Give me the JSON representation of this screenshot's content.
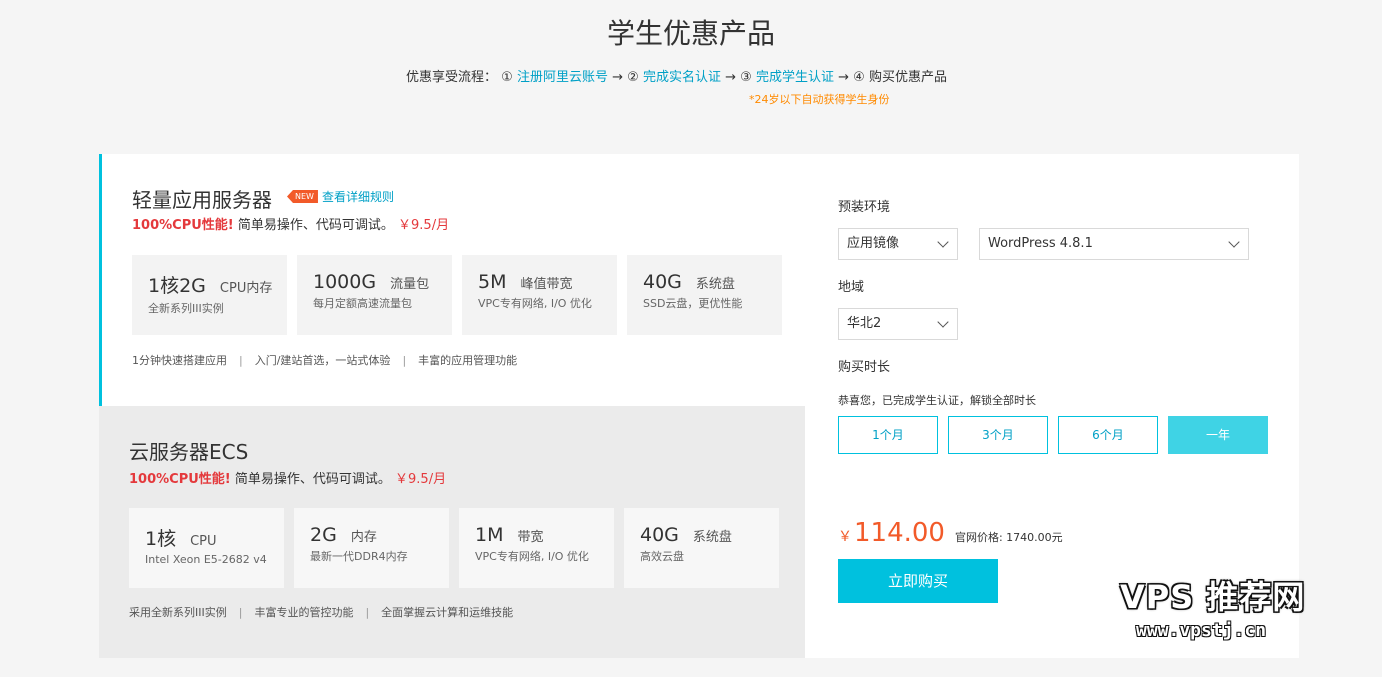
{
  "page": {
    "title": "学生优惠产品",
    "flow_label": "优惠享受流程：",
    "steps": [
      {
        "num": "①",
        "label": "注册阿里云账号"
      },
      {
        "num": "②",
        "label": "完成实名认证"
      },
      {
        "num": "③",
        "label": "完成学生认证"
      },
      {
        "num": "④",
        "label": "购买优惠产品"
      }
    ],
    "arrow": "→",
    "note": "*24岁以下自动获得学生身份"
  },
  "products": [
    {
      "title": "轻量应用服务器",
      "badge": "NEW",
      "rules_link": "查看详细规则",
      "highlight": "100%CPU性能!",
      "desc": "简单易操作、代码可调试。",
      "price": "￥9.5/月",
      "specs": [
        {
          "value": "1核2G",
          "unit": "CPU内存",
          "sub": "全新系列III实例"
        },
        {
          "value": "1000G",
          "unit": "流量包",
          "sub": "每月定额高速流量包"
        },
        {
          "value": "5M",
          "unit": "峰值带宽",
          "sub": "VPC专有网络, I/O 优化"
        },
        {
          "value": "40G",
          "unit": "系统盘",
          "sub": "SSD云盘，更优性能"
        }
      ],
      "features": [
        "1分钟快速搭建应用",
        "入门/建站首选，一站式体验",
        "丰富的应用管理功能"
      ]
    },
    {
      "title": "云服务器ECS",
      "highlight": "100%CPU性能!",
      "desc": "简单易操作、代码可调试。",
      "price": "￥9.5/月",
      "specs": [
        {
          "value": "1核",
          "unit": "CPU",
          "sub": "Intel Xeon E5-2682 v4"
        },
        {
          "value": "2G",
          "unit": "内存",
          "sub": "最新一代DDR4内存"
        },
        {
          "value": "1M",
          "unit": "带宽",
          "sub": "VPC专有网络, I/O 优化"
        },
        {
          "value": "40G",
          "unit": "系统盘",
          "sub": "高效云盘"
        }
      ],
      "features": [
        "采用全新系列III实例",
        "丰富专业的管控功能",
        "全面掌握云计算和运维技能"
      ]
    }
  ],
  "features_sep": "|",
  "config": {
    "env_label": "预装环境",
    "image_type": "应用镜像",
    "image_version": "WordPress 4.8.1",
    "region_label": "地域",
    "region": "华北2",
    "duration_label": "购买时长",
    "congrats": "恭喜您，已完成学生认证，解锁全部时长",
    "durations": [
      "1个月",
      "3个月",
      "6个月",
      "一年"
    ],
    "selected_duration": "一年",
    "price_symbol": "￥",
    "price": "114.00",
    "original_price": "官网价格: 1740.00元",
    "buy_button": "立即购买"
  },
  "watermark": {
    "logo": "VPS 推荐网",
    "url": "www.vpstj.cn"
  },
  "colors": {
    "accent": "#00c1de",
    "link": "#00a0c6",
    "highlight_red": "#e4393c",
    "price_orange": "#f25a29",
    "note_orange": "#ff8a00"
  }
}
